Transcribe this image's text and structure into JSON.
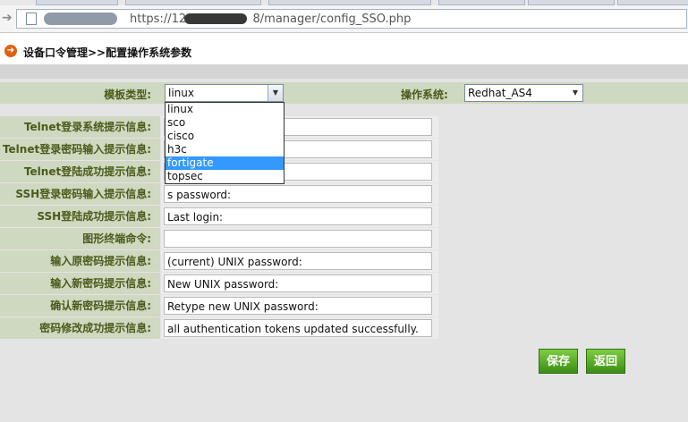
{
  "browser": {
    "url_text": "https://12                  8/manager/config_SSO.php"
  },
  "page": {
    "title": "设备口令管理>>配置操作系统参数"
  },
  "form": {
    "template_type_label": "模板类型:",
    "template_type_value": "linux",
    "os_label": "操作系统:",
    "os_value": "Redhat_AS4",
    "fields": [
      {
        "label": "Telnet登录系统提示信息:",
        "value": ""
      },
      {
        "label": "Telnet登录密码输入提示信息:",
        "value": ""
      },
      {
        "label": "Telnet登陆成功提示信息:",
        "value": ""
      },
      {
        "label": "SSH登录密码输入提示信息:",
        "value": "s password:"
      },
      {
        "label": "SSH登陆成功提示信息:",
        "value": "Last login:"
      },
      {
        "label": "图形终端命令:",
        "value": ""
      },
      {
        "label": "输入原密码提示信息:",
        "value": "(current) UNIX password:"
      },
      {
        "label": "输入新密码提示信息:",
        "value": "New UNIX password:"
      },
      {
        "label": "确认新密码提示信息:",
        "value": "Retype new UNIX password:"
      },
      {
        "label": "密码修改成功提示信息:",
        "value": "all authentication tokens updated successfully."
      }
    ]
  },
  "dropdown": {
    "options": [
      "linux",
      "sco",
      "cisco",
      "h3c",
      "fortigate",
      "topsec"
    ],
    "highlighted": "fortigate"
  },
  "buttons": {
    "save": "保存",
    "back": "返回"
  }
}
